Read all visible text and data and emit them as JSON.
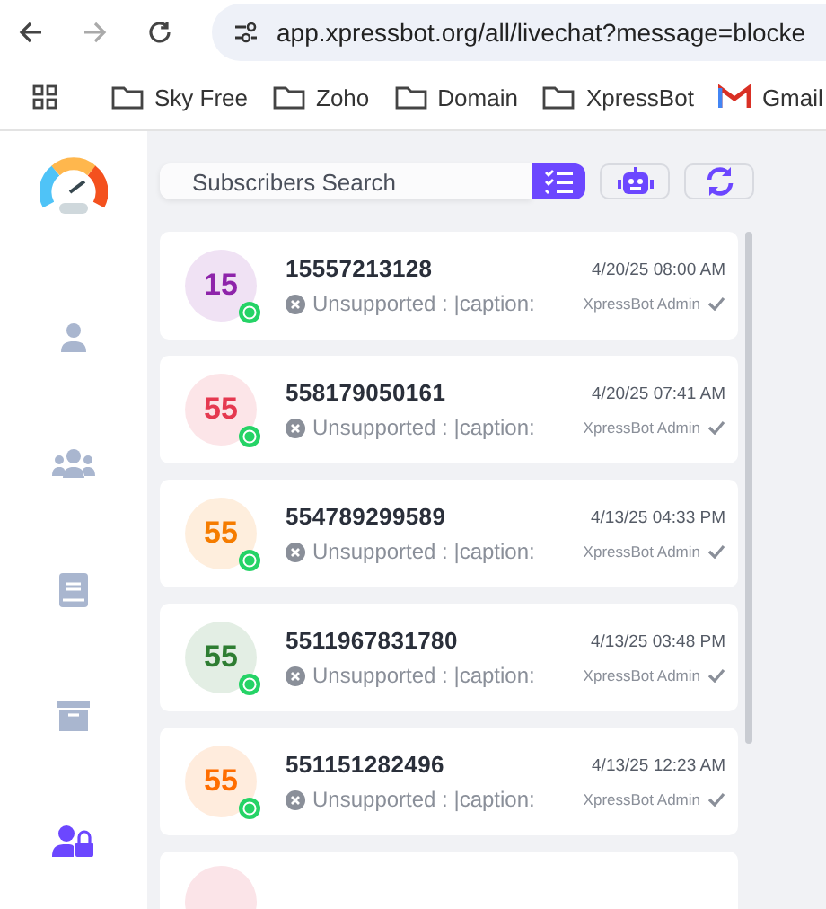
{
  "browser": {
    "url": "app.xpressbot.org/all/livechat?message=blocke"
  },
  "bookmarks": [
    {
      "label": "Sky Free",
      "kind": "folder"
    },
    {
      "label": "Zoho",
      "kind": "folder"
    },
    {
      "label": "Domain",
      "kind": "folder"
    },
    {
      "label": "XpressBot",
      "kind": "folder"
    },
    {
      "label": "Gmail",
      "kind": "mail"
    }
  ],
  "sidebar": {
    "items": [
      {
        "kind": "user",
        "selected": false
      },
      {
        "kind": "users",
        "selected": false
      },
      {
        "kind": "book",
        "selected": false
      },
      {
        "kind": "archive",
        "selected": false
      },
      {
        "kind": "user-lock",
        "selected": true
      }
    ]
  },
  "search": {
    "placeholder": "Subscribers Search"
  },
  "conversations": [
    {
      "initials": "15",
      "color": "#8e24aa",
      "number": "15557213128",
      "preview": "Unsupported : |caption:",
      "time": "4/20/25 08:00 AM",
      "agent": "XpressBot Admin"
    },
    {
      "initials": "55",
      "color": "#e53950",
      "number": "558179050161",
      "preview": "Unsupported : |caption:",
      "time": "4/20/25 07:41 AM",
      "agent": "XpressBot Admin"
    },
    {
      "initials": "55",
      "color": "#f57c00",
      "number": "554789299589",
      "preview": "Unsupported : |caption:",
      "time": "4/13/25 04:33 PM",
      "agent": "XpressBot Admin"
    },
    {
      "initials": "55",
      "color": "#2e7d32",
      "number": "5511967831780",
      "preview": "Unsupported : |caption:",
      "time": "4/13/25 03:48 PM",
      "agent": "XpressBot Admin"
    },
    {
      "initials": "55",
      "color": "#ff6d00",
      "number": "551151282496",
      "preview": "Unsupported : |caption:",
      "time": "4/13/25 12:23 AM",
      "agent": "XpressBot Admin"
    }
  ],
  "partial_conversation": {
    "color": "#fbe4e8"
  }
}
